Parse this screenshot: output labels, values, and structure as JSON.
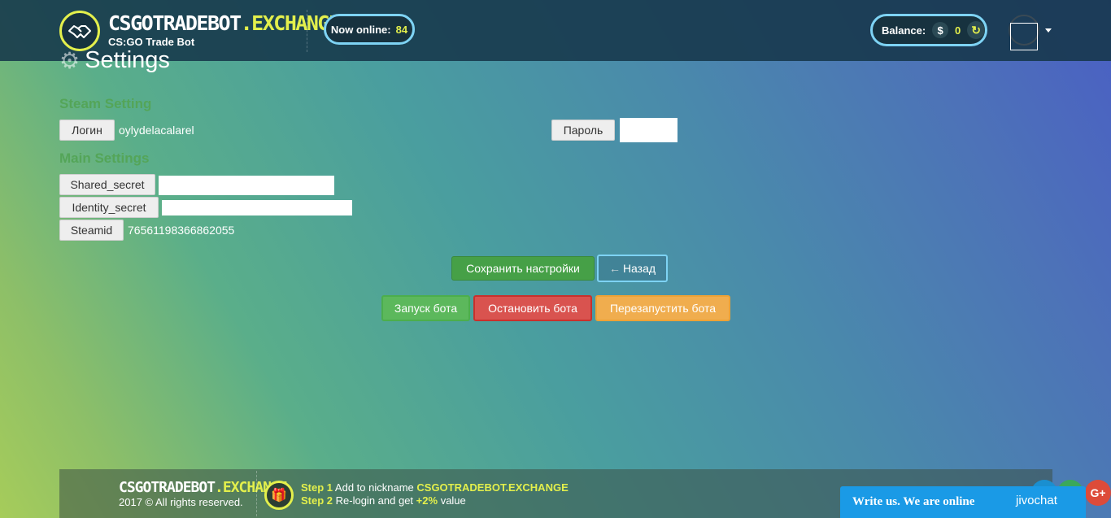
{
  "header": {
    "logo_main": "CSGOTRADEBOT",
    "logo_accent": ".EXCHANGE",
    "logo_sub": "CS:GO Trade Bot",
    "online_label": "Now online:",
    "online_count": "84",
    "balance_label": "Balance:",
    "balance_currency": "$",
    "balance_value": "0"
  },
  "page": {
    "title": "Settings"
  },
  "steam_section": {
    "title": "Steam Setting",
    "login_label": "Логин",
    "login_value": "oylydelacalarel",
    "password_label": "Пароль"
  },
  "main_section": {
    "title": "Main Settings",
    "shared_secret_label": "Shared_secret",
    "identity_secret_label": "Identity_secret",
    "steamid_label": "Steamid",
    "steamid_value": "76561198366862055"
  },
  "actions": {
    "save": "Сохранить настройки",
    "back": "Назад",
    "start": "Запуск бота",
    "stop": "Остановить бота",
    "restart": "Перезапустить бота"
  },
  "footer": {
    "logo_main": "CSGOTRADEBOT",
    "logo_accent": ".EXCHANGE",
    "copyright": "2017 © All rights reserved.",
    "step1_label": "Step 1",
    "step1_text": "Add to nickname",
    "step1_highlight": "CSGOTRADEBOT.EXCHANGE",
    "step2_label": "Step 2",
    "step2_text": "Re-login and get",
    "step2_highlight": "+2%",
    "step2_suffix": "value"
  },
  "chat": {
    "text": "Write us. We are online",
    "brand": "jivochat",
    "gplus": "G+"
  },
  "colors": {
    "accent_yellow": "#e3ef4c",
    "accent_blue": "#7ed3f4",
    "section_green": "#54a558",
    "save_green": "#46a047",
    "stop_red": "#d9534f",
    "restart_orange": "#f0ad4e"
  }
}
